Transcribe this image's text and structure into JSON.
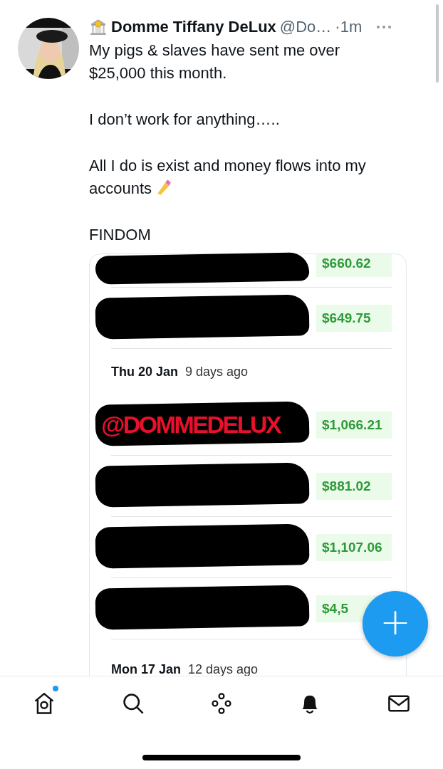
{
  "tweet": {
    "name": "Domme Tiffany DeLux",
    "handle": "@Do…",
    "time": "·1m",
    "paragraphs": [
      {
        "lines": [
          "My pigs & slaves have sent me over",
          "$25,000 this month."
        ],
        "emoji": false
      },
      {
        "lines": [
          "I don’t work for anything….."
        ],
        "emoji": false
      },
      {
        "lines": [
          "All I do is exist and money flows into my",
          "accounts"
        ],
        "emoji": true
      },
      {
        "lines": [
          "FINDOM"
        ],
        "emoji": false
      }
    ],
    "attached_screenshot": {
      "items": [
        {
          "kind": "payment",
          "amount": "$660.62"
        },
        {
          "kind": "payment",
          "amount": "$649.75"
        },
        {
          "kind": "date",
          "date": "Thu 20 Jan",
          "ago": "9 days ago"
        },
        {
          "kind": "payment",
          "amount": "$1,066.21",
          "overlay": "@DOMMEDELUX"
        },
        {
          "kind": "payment",
          "amount": "$881.02"
        },
        {
          "kind": "payment",
          "amount": "$1,107.06"
        },
        {
          "kind": "payment",
          "amount": "$4,5"
        },
        {
          "kind": "date",
          "date": "Mon 17 Jan",
          "ago": "12 days ago"
        }
      ]
    }
  },
  "compose_button": {
    "label": "+"
  },
  "nav": [
    {
      "kind": "home",
      "dot": true
    },
    {
      "kind": "search",
      "dot": false
    },
    {
      "kind": "spaces",
      "dot": false
    },
    {
      "kind": "notifications",
      "dot": false
    },
    {
      "kind": "messages",
      "dot": false
    }
  ]
}
